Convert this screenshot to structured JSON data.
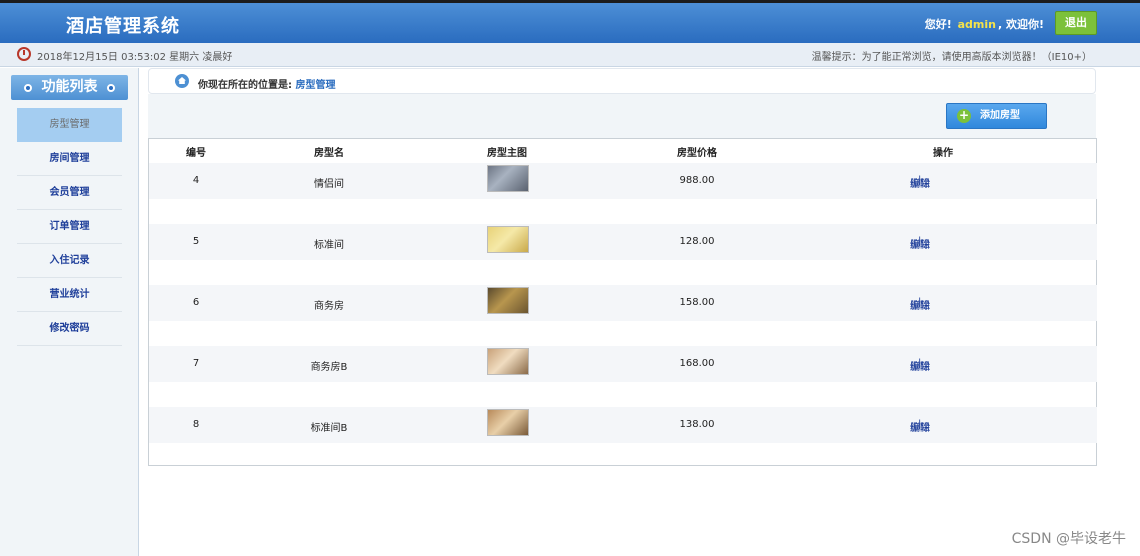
{
  "header": {
    "title": "酒店管理系统",
    "greeting_prefix": "您好!",
    "username": "admin",
    "greeting_suffix": ", 欢迎你!",
    "logout_label": "退出"
  },
  "status": {
    "datetime": "2018年12月15日 03:53:02 星期六   凌晨好",
    "tip": "温馨提示：为了能正常浏览，请使用高版本浏览器！（IE10+）"
  },
  "sidebar": {
    "title": "功能列表",
    "items": [
      {
        "label": "房型管理",
        "active": true
      },
      {
        "label": "房间管理"
      },
      {
        "label": "会员管理"
      },
      {
        "label": "订单管理"
      },
      {
        "label": "入住记录"
      },
      {
        "label": "营业统计"
      },
      {
        "label": "修改密码"
      }
    ]
  },
  "breadcrumb": {
    "prefix": "你现在所在的位置是:",
    "current": "房型管理"
  },
  "toolbar": {
    "add_label": "添加房型"
  },
  "table": {
    "columns": [
      "编号",
      "房型名",
      "房型主图",
      "房型价格",
      "操作"
    ],
    "rows": [
      {
        "id": "4",
        "name": "情侣间",
        "price": "988.00",
        "edit": "编辑",
        "delete": "删除"
      },
      {
        "id": "5",
        "name": "标准间",
        "price": "128.00",
        "edit": "编辑",
        "delete": "删除"
      },
      {
        "id": "6",
        "name": "商务房",
        "price": "158.00",
        "edit": "编辑",
        "delete": "删除"
      },
      {
        "id": "7",
        "name": "商务房B",
        "price": "168.00",
        "edit": "编辑",
        "delete": "删除"
      },
      {
        "id": "8",
        "name": "标准间B",
        "price": "138.00",
        "edit": "编辑",
        "delete": "删除"
      }
    ]
  },
  "watermark": "CSDN @毕设老牛"
}
